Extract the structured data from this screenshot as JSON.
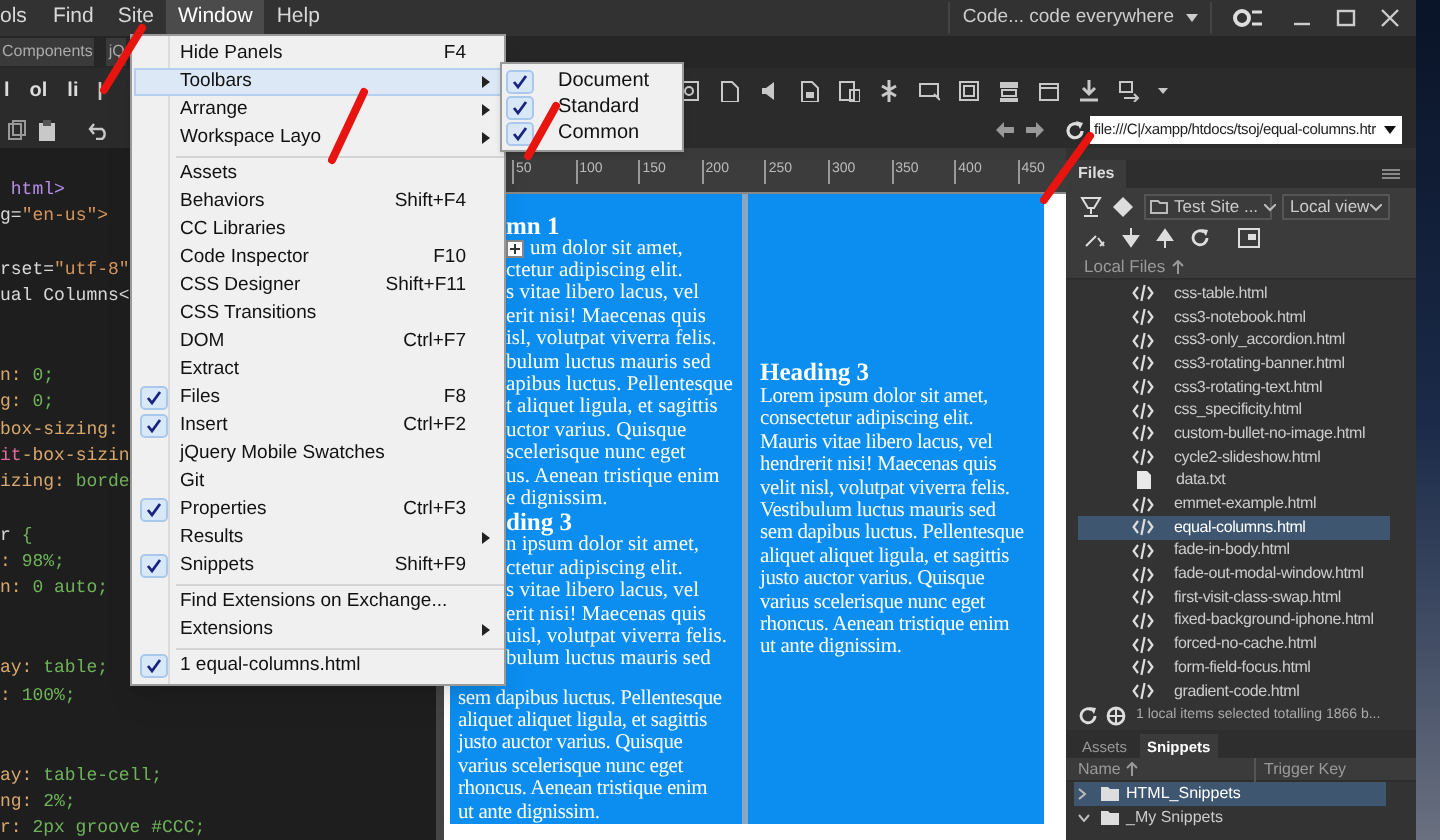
{
  "menu_bar": {
    "items": [
      {
        "label": "ols",
        "selected": false
      },
      {
        "label": "Find",
        "selected": false
      },
      {
        "label": "Site",
        "selected": false
      },
      {
        "label": "Window",
        "selected": true
      },
      {
        "label": "Help",
        "selected": false
      }
    ]
  },
  "workspace_switcher": {
    "label": "Code... code everywhere"
  },
  "document_tabs": [
    "Components",
    "jQ"
  ],
  "insert_toolbar": [
    "l",
    "ol",
    "li"
  ],
  "address_bar": {
    "value": "file:///C|/xampp/htdocs/tsoj/equal-columns.htr"
  },
  "ruler": {
    "ticks": [
      "50",
      "100",
      "150",
      "200",
      "250",
      "300",
      "350",
      "400",
      "450"
    ]
  },
  "code_lines": [
    {
      "kind": "code",
      "segments": [
        {
          "kind": "tag",
          "text": " html>"
        }
      ]
    },
    {
      "kind": "code",
      "segments": [
        {
          "kind": "attr",
          "text": "g="
        },
        {
          "kind": "string",
          "text": "\"en-us\">"
        }
      ]
    },
    {
      "kind": "blank"
    },
    {
      "kind": "code",
      "segments": [
        {
          "kind": "attr",
          "text": "rset="
        },
        {
          "kind": "string",
          "text": "\"utf-8\""
        }
      ]
    },
    {
      "kind": "code",
      "segments": [
        {
          "kind": "plain",
          "text": "ual Columns<"
        }
      ]
    },
    {
      "kind": "blank"
    },
    {
      "kind": "blank"
    },
    {
      "kind": "code",
      "segments": [
        {
          "kind": "prop",
          "text": "n: "
        },
        {
          "kind": "value",
          "text": "0;"
        }
      ]
    },
    {
      "kind": "code",
      "segments": [
        {
          "kind": "prop",
          "text": "g: "
        },
        {
          "kind": "value",
          "text": "0;"
        }
      ]
    },
    {
      "kind": "code",
      "segments": [
        {
          "kind": "prop",
          "text": "box-sizing:"
        }
      ]
    },
    {
      "kind": "code",
      "segments": [
        {
          "kind": "vendor",
          "text": "it"
        },
        {
          "kind": "prop",
          "text": "-box-sizin"
        }
      ]
    },
    {
      "kind": "code",
      "segments": [
        {
          "kind": "prop",
          "text": "izing: "
        },
        {
          "kind": "value",
          "text": "borde"
        }
      ]
    },
    {
      "kind": "blank"
    },
    {
      "kind": "code",
      "segments": [
        {
          "kind": "plain",
          "text": "r "
        },
        {
          "kind": "value",
          "text": "{"
        }
      ]
    },
    {
      "kind": "code",
      "segments": [
        {
          "kind": "prop",
          "text": ": "
        },
        {
          "kind": "value",
          "text": "98%;"
        }
      ]
    },
    {
      "kind": "code",
      "segments": [
        {
          "kind": "prop",
          "text": "n: "
        },
        {
          "kind": "value",
          "text": "0 auto;"
        }
      ]
    },
    {
      "kind": "blank"
    },
    {
      "kind": "blank"
    },
    {
      "kind": "code",
      "segments": [
        {
          "kind": "prop",
          "text": "ay: "
        },
        {
          "kind": "value",
          "text": "table;"
        }
      ]
    },
    {
      "kind": "code",
      "segments": [
        {
          "kind": "prop",
          "text": ": "
        },
        {
          "kind": "value",
          "text": "100%;"
        }
      ]
    },
    {
      "kind": "blank"
    },
    {
      "kind": "blank"
    },
    {
      "kind": "code",
      "segments": [
        {
          "kind": "prop",
          "text": "ay: "
        },
        {
          "kind": "value",
          "text": "table-cell;"
        }
      ]
    },
    {
      "kind": "code",
      "segments": [
        {
          "kind": "prop",
          "text": "ng: "
        },
        {
          "kind": "value",
          "text": "2%;"
        }
      ]
    },
    {
      "kind": "code",
      "segments": [
        {
          "kind": "prop",
          "text": "r: "
        },
        {
          "kind": "value",
          "text": "2px groove #CCC;"
        }
      ]
    }
  ],
  "design_view": {
    "column_1": {
      "lines_beside_menu": [
        {
          "kind": "heading",
          "text": "mn 1"
        },
        {
          "kind": "insert_text",
          "text": "um dolor sit amet,"
        },
        {
          "kind": "text",
          "text": "ctetur adipiscing elit."
        },
        {
          "kind": "text",
          "text": "s vitae libero lacus, vel"
        },
        {
          "kind": "text",
          "text": "erit nisi! Maecenas quis"
        },
        {
          "kind": "text",
          "text": "isl, volutpat viverra felis."
        },
        {
          "kind": "text",
          "text": "bulum luctus mauris sed"
        },
        {
          "kind": "text",
          "text": "apibus luctus. Pellentesque"
        },
        {
          "kind": "text",
          "text": "t aliquet ligula, et sagittis"
        },
        {
          "kind": "text",
          "text": "uctor varius. Quisque"
        },
        {
          "kind": "text",
          "text": "scelerisque nunc eget"
        },
        {
          "kind": "text",
          "text": "us. Aenean tristique enim"
        },
        {
          "kind": "text",
          "text": "e dignissim."
        },
        {
          "kind": "heading",
          "text": "ding 3"
        },
        {
          "kind": "text",
          "text": "n ipsum dolor sit amet,"
        },
        {
          "kind": "text",
          "text": "ctetur adipiscing elit."
        },
        {
          "kind": "text",
          "text": "s vitae libero lacus, vel"
        },
        {
          "kind": "text",
          "text": "erit nisi! Maecenas quis"
        },
        {
          "kind": "text",
          "text": "uisl, volutpat viverra felis."
        },
        {
          "kind": "text",
          "text": "bulum luctus mauris sed"
        }
      ],
      "lines_below_menu": [
        "sem dapibus luctus. Pellentesque",
        "aliquet aliquet ligula, et sagittis",
        "justo auctor varius. Quisque",
        "varius scelerisque nunc eget",
        "rhoncus. Aenean tristique enim",
        "ut ante dignissim."
      ]
    },
    "column_2": {
      "heading": "Heading 3",
      "paragraph": "Lorem ipsum dolor sit amet, consectetur adipiscing elit. Mauris vitae libero lacus, vel hendrerit nisi! Maecenas quis velit nisl, volutpat viverra felis. Vestibulum luctus mauris sed sem dapibus luctus. Pellentesque aliquet aliquet ligula, et sagittis justo auctor varius. Quisque varius scelerisque nunc eget rhoncus. Aenean tristique enim ut ante dignissim."
    }
  },
  "window_menu": {
    "items": [
      {
        "kind": "item",
        "label": "Hide Panels",
        "shortcut": "F4",
        "checked": false,
        "submenu": false,
        "selected": false
      },
      {
        "kind": "item",
        "label": "Toolbars",
        "checked": false,
        "submenu": true,
        "selected": true
      },
      {
        "kind": "item",
        "label": "Arrange",
        "checked": false,
        "submenu": true,
        "selected": false
      },
      {
        "kind": "item",
        "label": "Workspace Layo",
        "checked": false,
        "submenu": true,
        "selected": false
      },
      {
        "kind": "separator"
      },
      {
        "kind": "item",
        "label": "Assets",
        "checked": false,
        "submenu": false,
        "selected": false
      },
      {
        "kind": "item",
        "label": "Behaviors",
        "shortcut": "Shift+F4",
        "checked": false,
        "submenu": false,
        "selected": false
      },
      {
        "kind": "item",
        "label": "CC Libraries",
        "checked": false,
        "submenu": false,
        "selected": false
      },
      {
        "kind": "item",
        "label": "Code Inspector",
        "shortcut": "F10",
        "checked": false,
        "submenu": false,
        "selected": false
      },
      {
        "kind": "item",
        "label": "CSS Designer",
        "shortcut": "Shift+F11",
        "checked": false,
        "submenu": false,
        "selected": false
      },
      {
        "kind": "item",
        "label": "CSS Transitions",
        "checked": false,
        "submenu": false,
        "selected": false
      },
      {
        "kind": "item",
        "label": "DOM",
        "shortcut": "Ctrl+F7",
        "checked": false,
        "submenu": false,
        "selected": false
      },
      {
        "kind": "item",
        "label": "Extract",
        "checked": false,
        "submenu": false,
        "selected": false
      },
      {
        "kind": "item",
        "label": "Files",
        "shortcut": "F8",
        "checked": true,
        "submenu": false,
        "selected": false
      },
      {
        "kind": "item",
        "label": "Insert",
        "shortcut": "Ctrl+F2",
        "checked": true,
        "submenu": false,
        "selected": false
      },
      {
        "kind": "item",
        "label": "jQuery Mobile Swatches",
        "checked": false,
        "submenu": false,
        "selected": false
      },
      {
        "kind": "item",
        "label": "Git",
        "checked": false,
        "submenu": false,
        "selected": false
      },
      {
        "kind": "item",
        "label": "Properties",
        "shortcut": "Ctrl+F3",
        "checked": true,
        "submenu": false,
        "selected": false
      },
      {
        "kind": "item",
        "label": "Results",
        "checked": false,
        "submenu": true,
        "selected": false
      },
      {
        "kind": "item",
        "label": "Snippets",
        "shortcut": "Shift+F9",
        "checked": true,
        "submenu": false,
        "selected": false
      },
      {
        "kind": "separator"
      },
      {
        "kind": "item",
        "label": "Find Extensions on Exchange...",
        "checked": false,
        "submenu": false,
        "selected": false
      },
      {
        "kind": "item",
        "label": "Extensions",
        "checked": false,
        "submenu": true,
        "selected": false
      },
      {
        "kind": "separator"
      },
      {
        "kind": "item",
        "label": "1 equal-columns.html",
        "checked": true,
        "submenu": false,
        "selected": false
      }
    ]
  },
  "toolbars_submenu": {
    "items": [
      {
        "label": "Document",
        "checked": true
      },
      {
        "label": "Standard",
        "checked": true
      },
      {
        "label": "Common",
        "checked": true
      }
    ]
  },
  "files_panel": {
    "tab": "Files",
    "site": "Test Site ...",
    "view": "Local view",
    "column_header": "Local Files",
    "files": [
      {
        "name": "css-table.html",
        "kind": "html",
        "selected": false
      },
      {
        "name": "css3-notebook.html",
        "kind": "html",
        "selected": false
      },
      {
        "name": "css3-only_accordion.html",
        "kind": "html",
        "selected": false
      },
      {
        "name": "css3-rotating-banner.html",
        "kind": "html",
        "selected": false
      },
      {
        "name": "css3-rotating-text.html",
        "kind": "html",
        "selected": false
      },
      {
        "name": "css_specificity.html",
        "kind": "html",
        "selected": false
      },
      {
        "name": "custom-bullet-no-image.html",
        "kind": "html",
        "selected": false
      },
      {
        "name": "cycle2-slideshow.html",
        "kind": "html",
        "selected": false
      },
      {
        "name": "data.txt",
        "kind": "text",
        "selected": false
      },
      {
        "name": "emmet-example.html",
        "kind": "html",
        "selected": false
      },
      {
        "name": "equal-columns.html",
        "kind": "html",
        "selected": true
      },
      {
        "name": "fade-in-body.html",
        "kind": "html",
        "selected": false
      },
      {
        "name": "fade-out-modal-window.html",
        "kind": "html",
        "selected": false
      },
      {
        "name": "first-visit-class-swap.html",
        "kind": "html",
        "selected": false
      },
      {
        "name": "fixed-background-iphone.html",
        "kind": "html",
        "selected": false
      },
      {
        "name": "forced-no-cache.html",
        "kind": "html",
        "selected": false
      },
      {
        "name": "form-field-focus.html",
        "kind": "html",
        "selected": false
      },
      {
        "name": "gradient-code.html",
        "kind": "html",
        "selected": false
      }
    ],
    "status": "1 local items selected totalling 1866 b..."
  },
  "snippets_panel": {
    "tabs": [
      {
        "label": "Assets",
        "selected": false
      },
      {
        "label": "Snippets",
        "selected": true
      }
    ],
    "columns": [
      "Name",
      "Trigger Key"
    ],
    "items": [
      {
        "name": "HTML_Snippets",
        "expanded": false,
        "selected": true
      },
      {
        "name": "_My Snippets",
        "expanded": true,
        "selected": false
      }
    ]
  }
}
